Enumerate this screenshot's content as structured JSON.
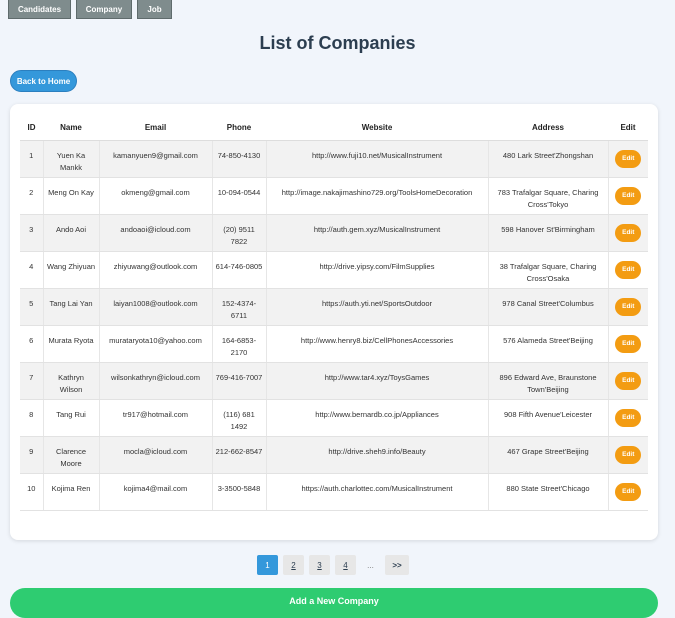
{
  "nav": {
    "candidates": "Candidates",
    "company": "Company",
    "job": "Job"
  },
  "page_title": "List of Companies",
  "back_button": "Back to Home",
  "table": {
    "headers": [
      "ID",
      "Name",
      "Email",
      "Phone",
      "Website",
      "Address",
      "Edit"
    ],
    "edit_label": "Edit",
    "rows": [
      {
        "id": "1",
        "name": "Yuen Ka Mankk",
        "email": "kamanyuen9@gmail.com",
        "phone": "74-850-4130",
        "website": "http://www.fuji10.net/MusicalInstrument",
        "address": "480 Lark Street'Zhongshan"
      },
      {
        "id": "2",
        "name": "Meng On Kay",
        "email": "okmeng@gmail.com",
        "phone": "10-094-0544",
        "website": "http://image.nakajimashino729.org/ToolsHomeDecoration",
        "address": "783 Trafalgar Square, Charing Cross'Tokyo"
      },
      {
        "id": "3",
        "name": "Ando Aoi",
        "email": "andoaoi@icloud.com",
        "phone": "(20) 9511 7822",
        "website": "http://auth.gem.xyz/MusicalInstrument",
        "address": "598 Hanover St'Birmingham"
      },
      {
        "id": "4",
        "name": "Wang Zhiyuan",
        "email": "zhiyuwang@outlook.com",
        "phone": "614-746-0805",
        "website": "http://drive.yipsy.com/FilmSupplies",
        "address": "38 Trafalgar Square, Charing Cross'Osaka"
      },
      {
        "id": "5",
        "name": "Tang Lai Yan",
        "email": "laiyan1008@outlook.com",
        "phone": "152-4374-6711",
        "website": "https://auth.yti.net/SportsOutdoor",
        "address": "978 Canal Street'Columbus"
      },
      {
        "id": "6",
        "name": "Murata Ryota",
        "email": "murataryota10@yahoo.com",
        "phone": "164-6853-2170",
        "website": "http://www.henry8.biz/CellPhonesAccessories",
        "address": "576 Alameda Street'Beijing"
      },
      {
        "id": "7",
        "name": "Kathryn Wilson",
        "email": "wilsonkathryn@icloud.com",
        "phone": "769-416-7007",
        "website": "http://www.tar4.xyz/ToysGames",
        "address": "896 Edward Ave, Braunstone Town'Beijing"
      },
      {
        "id": "8",
        "name": "Tang Rui",
        "email": "tr917@hotmail.com",
        "phone": "(116) 681 1492",
        "website": "http://www.bernardb.co.jp/Appliances",
        "address": "908 Fifth Avenue'Leicester"
      },
      {
        "id": "9",
        "name": "Clarence Moore",
        "email": "mocla@icloud.com",
        "phone": "212-662-8547",
        "website": "http://drive.sheh9.info/Beauty",
        "address": "467 Grape Street'Beijing"
      },
      {
        "id": "10",
        "name": "Kojima Ren",
        "email": "kojima4@mail.com",
        "phone": "3-3500-5848",
        "website": "https://auth.charlottec.com/MusicalInstrument",
        "address": "880 State Street'Chicago"
      }
    ]
  },
  "pagination": {
    "pages": [
      "1",
      "2",
      "3",
      "4"
    ],
    "current": "1",
    "ellipsis": "...",
    "next": ">>"
  },
  "add_button": "Add a New Company",
  "colors": {
    "primary": "#3498db",
    "edit": "#f39c12",
    "add": "#2ecc71",
    "nav": "#7f8c8d"
  }
}
